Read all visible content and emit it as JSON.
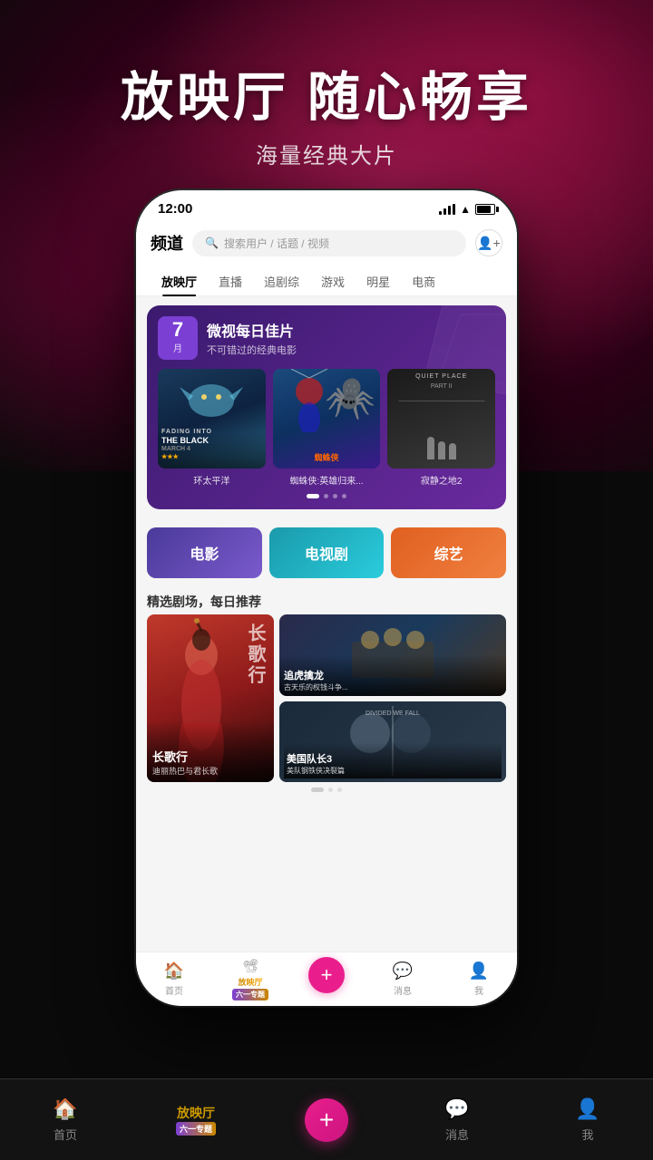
{
  "app": {
    "hero_title": "放映厅 随心畅享",
    "hero_subtitle": "海量经典大片"
  },
  "phone": {
    "status_bar": {
      "time": "12:00"
    },
    "header": {
      "logo": "频道",
      "search_placeholder": "搜索用户 / 话题 / 视频"
    },
    "nav_tabs": [
      {
        "label": "放映厅",
        "active": true
      },
      {
        "label": "直播",
        "active": false
      },
      {
        "label": "追剧综",
        "active": false
      },
      {
        "label": "游戏",
        "active": false
      },
      {
        "label": "明星",
        "active": false
      },
      {
        "label": "电商",
        "active": false
      }
    ],
    "featured_card": {
      "date_num": "7",
      "date_unit": "月",
      "title": "微视每日佳片",
      "subtitle": "不可错过的经典电影"
    },
    "movie_posters": [
      {
        "title": "环太平洋",
        "type": "pacific"
      },
      {
        "title": "蜘蛛侠:英雄归来...",
        "type": "spider"
      },
      {
        "title": "寂静之地2",
        "type": "quiet"
      }
    ],
    "categories": [
      {
        "label": "电影",
        "type": "movie"
      },
      {
        "label": "电视剧",
        "type": "tv"
      },
      {
        "label": "综艺",
        "type": "variety"
      }
    ],
    "drama_section_title": "精选剧场，每日推荐",
    "dramas": [
      {
        "title": "长歌行",
        "subtitle": "迪丽热巴与君长歌",
        "type": "changge",
        "size": "large"
      },
      {
        "title": "追虎擒龙",
        "subtitle": "古天乐的权钱斗争...",
        "type": "zhui",
        "size": "small"
      },
      {
        "title": "美国队长3",
        "subtitle": "美队钢铁侠决裂篇",
        "type": "cap",
        "size": "small"
      }
    ],
    "bottom_nav": [
      {
        "label": "首页",
        "icon": "🏠",
        "active": false
      },
      {
        "label": "放映厅",
        "icon": "📽",
        "active": true
      },
      {
        "label": "+",
        "icon": "+",
        "active": false,
        "center": true
      },
      {
        "label": "消息",
        "icon": "💬",
        "active": false
      },
      {
        "label": "我",
        "icon": "👤",
        "active": false
      }
    ]
  },
  "outer_nav": {
    "items": [
      {
        "label": "首页",
        "icon": "🏠"
      },
      {
        "label": "放映厅",
        "icon": "📽"
      },
      {
        "label": "+",
        "center": true
      },
      {
        "label": "消息",
        "icon": "💬"
      },
      {
        "label": "我",
        "icon": "👤"
      }
    ]
  }
}
